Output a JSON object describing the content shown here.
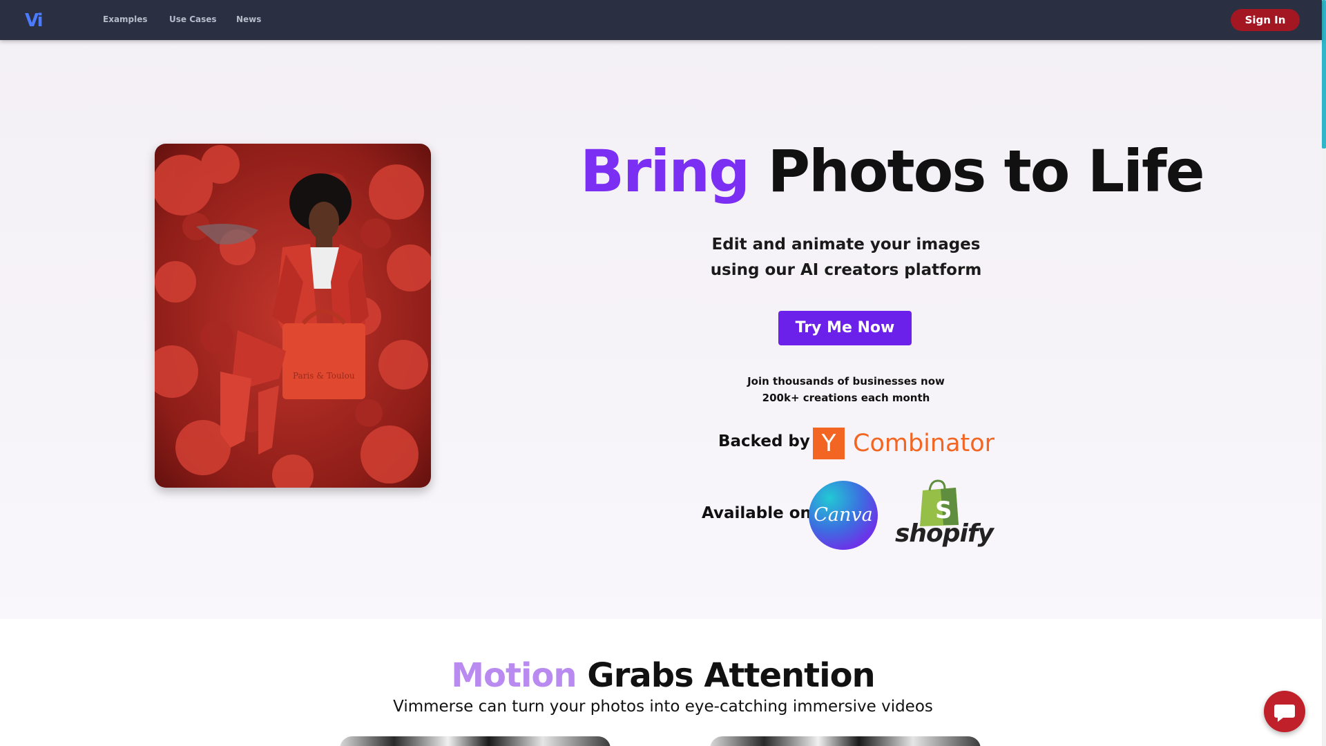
{
  "nav": {
    "logo_text": "Vi",
    "links": [
      "Examples",
      "Use Cases",
      "News"
    ],
    "signin_label": "Sign In"
  },
  "hero": {
    "title_accent": "Bring",
    "title_rest": "Photos to Life",
    "subtitle_line1": "Edit and animate your images",
    "subtitle_line2": "using our AI creators platform",
    "cta_label": "Try Me Now",
    "proof_line1": "Join thousands of businesses now",
    "proof_line2": "200k+ creations each month",
    "backed_label": "Backed by",
    "yc_letter": "Y",
    "yc_word": "Combinator",
    "available_label": "Available on",
    "canva_label": "Canva",
    "shopify_label": "shopify",
    "image_bag_text": "Paris & Toulou"
  },
  "section2": {
    "title_accent": "Motion",
    "title_rest": "Grabs Attention",
    "subtitle": "Vimmerse can turn your photos into eye-catching immersive videos"
  },
  "colors": {
    "nav_bg": "#2b2f42",
    "accent_purple": "#7b2ff2",
    "cta_purple": "#6b21ea",
    "signin_red": "#a31722",
    "yc_orange": "#f26522",
    "motion_lavender": "#b98af0",
    "chat_red": "#c0202a"
  }
}
